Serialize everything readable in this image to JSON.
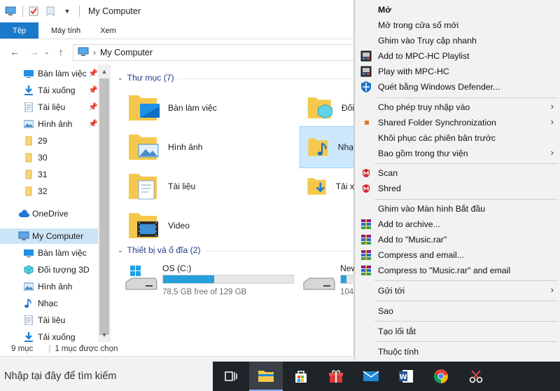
{
  "window": {
    "title": "My Computer",
    "ribbon_tabs": [
      "Tệp",
      "Máy tính",
      "Xem"
    ],
    "address": "My Computer"
  },
  "nav": {
    "quick": [
      {
        "label": "Bàn làm việc",
        "icon": "desktop-icon",
        "pinned": true
      },
      {
        "label": "Tải xuống",
        "icon": "download-icon",
        "pinned": true
      },
      {
        "label": "Tài liệu",
        "icon": "document-icon",
        "pinned": true
      },
      {
        "label": "Hình ảnh",
        "icon": "picture-icon",
        "pinned": true
      },
      {
        "label": "29",
        "icon": "folder-icon",
        "pinned": false
      },
      {
        "label": "30",
        "icon": "folder-icon",
        "pinned": false
      },
      {
        "label": "31",
        "icon": "folder-icon",
        "pinned": false
      },
      {
        "label": "32",
        "icon": "folder-icon",
        "pinned": false
      }
    ],
    "onedrive": "OneDrive",
    "this_pc": "My Computer",
    "pc_children": [
      {
        "label": "Bàn làm việc",
        "icon": "desktop-icon"
      },
      {
        "label": "Đối tượng 3D",
        "icon": "cube-icon"
      },
      {
        "label": "Hình ảnh",
        "icon": "picture-icon"
      },
      {
        "label": "Nhạc",
        "icon": "music-icon"
      },
      {
        "label": "Tài liệu",
        "icon": "document-icon"
      },
      {
        "label": "Tải xuống",
        "icon": "download-icon"
      }
    ]
  },
  "content": {
    "folders_header": "Thư mục (7)",
    "folders": [
      {
        "label": "Bàn làm việc"
      },
      {
        "label": "Đối"
      },
      {
        "label": "Hình ảnh"
      },
      {
        "label": "Nhạ"
      },
      {
        "label": "Tài liệu"
      },
      {
        "label": "Tải x"
      },
      {
        "label": "Video"
      }
    ],
    "devices_header": "Thiết bị và ổ đĩa (2)",
    "drives": [
      {
        "label": "OS (C:)",
        "free": "78,5 GB free of 129 GB",
        "used_fraction": 0.39
      },
      {
        "label": "New",
        "free": "104",
        "used_fraction": 0.2
      }
    ]
  },
  "status": {
    "count": "9 mục",
    "selected": "1 mục được chọn"
  },
  "context_menu": {
    "items": [
      {
        "label": "Mở",
        "bold": true
      },
      {
        "label": "Mở trong cửa sổ mới"
      },
      {
        "label": "Ghim vào Truy cập nhanh"
      },
      {
        "label": "Add to MPC-HC Playlist",
        "icon": "mpc-hc-icon"
      },
      {
        "label": "Play with MPC-HC",
        "icon": "mpc-hc-icon"
      },
      {
        "label": "Quét bằng Windows Defender...",
        "icon": "defender-shield-icon"
      },
      {
        "label": "Cho phép truy nhập vào",
        "submenu": true
      },
      {
        "label": "Shared Folder Synchronization",
        "icon": "sync-icon",
        "submenu": true
      },
      {
        "label": "Khôi phục các phiên bản trước"
      },
      {
        "label": "Bao gồm trong thư viện",
        "submenu": true
      },
      {
        "label": "Scan",
        "icon": "mcafee-icon"
      },
      {
        "label": "Shred",
        "icon": "mcafee-icon"
      },
      {
        "label": "Ghim vào Màn hình Bắt đầu"
      },
      {
        "label": "Add to archive...",
        "icon": "winrar-icon"
      },
      {
        "label": "Add to \"Music.rar\"",
        "icon": "winrar-icon"
      },
      {
        "label": "Compress and email...",
        "icon": "winrar-icon"
      },
      {
        "label": "Compress to \"Music.rar\" and email",
        "icon": "winrar-icon"
      },
      {
        "label": "Gửi tới",
        "submenu": true
      },
      {
        "label": "Sao"
      },
      {
        "label": "Tạo lối tắt"
      },
      {
        "label": "Thuộc tính"
      }
    ]
  },
  "taskbar": {
    "search_placeholder": "Nhập tại đây để tìm kiếm",
    "apps": [
      "task-view-icon",
      "file-explorer-icon",
      "store-icon",
      "gift-icon",
      "mail-icon",
      "word-icon",
      "chrome-icon",
      "snipping-tool-icon"
    ]
  },
  "colors": {
    "accent": "#1979ca",
    "selection": "#cce8ff",
    "group_header": "#1e3b87",
    "taskbar": "#1f2429"
  }
}
